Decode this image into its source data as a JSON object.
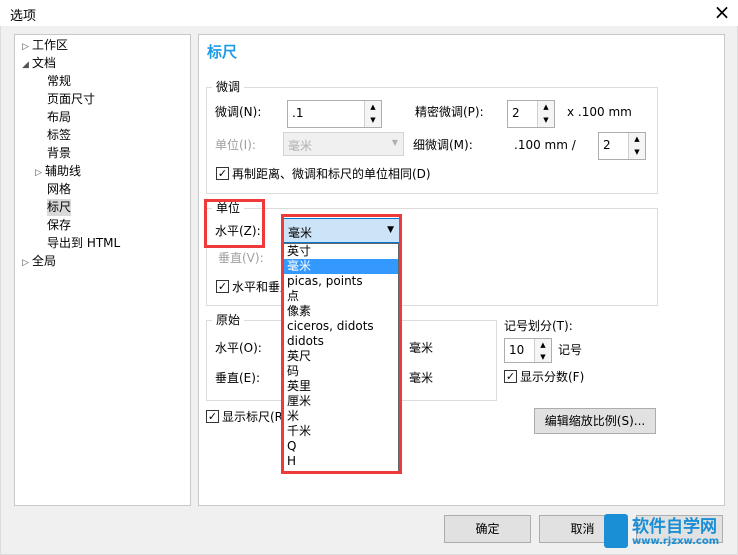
{
  "window": {
    "title": "选项",
    "close_icon": "×"
  },
  "tree": [
    {
      "label": "工作区",
      "level": 0,
      "expander": "collapsed"
    },
    {
      "label": "文档",
      "level": 0,
      "expander": "expanded"
    },
    {
      "label": "常规",
      "level": 1
    },
    {
      "label": "页面尺寸",
      "level": 1
    },
    {
      "label": "布局",
      "level": 1
    },
    {
      "label": "标签",
      "level": 1
    },
    {
      "label": "背景",
      "level": 1
    },
    {
      "label": "辅助线",
      "level": 1,
      "expander": "collapsed"
    },
    {
      "label": "网格",
      "level": 1
    },
    {
      "label": "标尺",
      "level": 1,
      "selected": true
    },
    {
      "label": "保存",
      "level": 1
    },
    {
      "label": "导出到 HTML",
      "level": 1
    },
    {
      "label": "全局",
      "level": 0,
      "expander": "collapsed"
    }
  ],
  "page": {
    "heading": "标尺"
  },
  "nudge": {
    "legend": "微调",
    "nudge_label": "微调(N):",
    "nudge_value": ".1",
    "super_label": "精密微调(P):",
    "super_value": "2",
    "super_suffix": "x .100 mm",
    "unit_label": "单位(I):",
    "unit_value": "毫米",
    "micro_label": "细微调(M):",
    "micro_prefix": ".100 mm /",
    "micro_value": "2",
    "same_units_label": "再制距离、微调和标尺的单位相同(D)",
    "same_units_checked": true
  },
  "units": {
    "legend": "单位",
    "horizontal_label": "水平(Z):",
    "horizontal_value": "毫米",
    "vertical_label": "垂直(V):",
    "same_label": "水平和垂直标尺的单位相同(U)",
    "same_checked": true,
    "options": [
      "英寸",
      "毫米",
      "picas, points",
      "点",
      "像素",
      "ciceros, didots",
      "didots",
      "英尺",
      "码",
      "英里",
      "厘米",
      "米",
      "千米",
      "Q",
      "H"
    ],
    "highlighted_index": 1
  },
  "origin": {
    "legend": "原始",
    "horizontal_label": "水平(O):",
    "horizontal_unit": "毫米",
    "vertical_label": "垂直(E):",
    "vertical_unit": "毫米"
  },
  "ticks": {
    "label": "记号划分(T):",
    "value": "10",
    "suffix": "记号",
    "show_fractions_label": "显示分数(F)",
    "show_fractions_checked": true
  },
  "show_rulers": {
    "label": "显示标尺(R)",
    "checked": true
  },
  "buttons": {
    "edit_scale": "编辑缩放比例(S)...",
    "ok": "确定",
    "cancel": "取消"
  },
  "watermark": {
    "text": "软件自学网",
    "url": "www.rjzxw.com"
  },
  "colors": {
    "heading": "#1e9be8",
    "highlight": "#3399ff",
    "annotation": "#ee3a3a"
  }
}
